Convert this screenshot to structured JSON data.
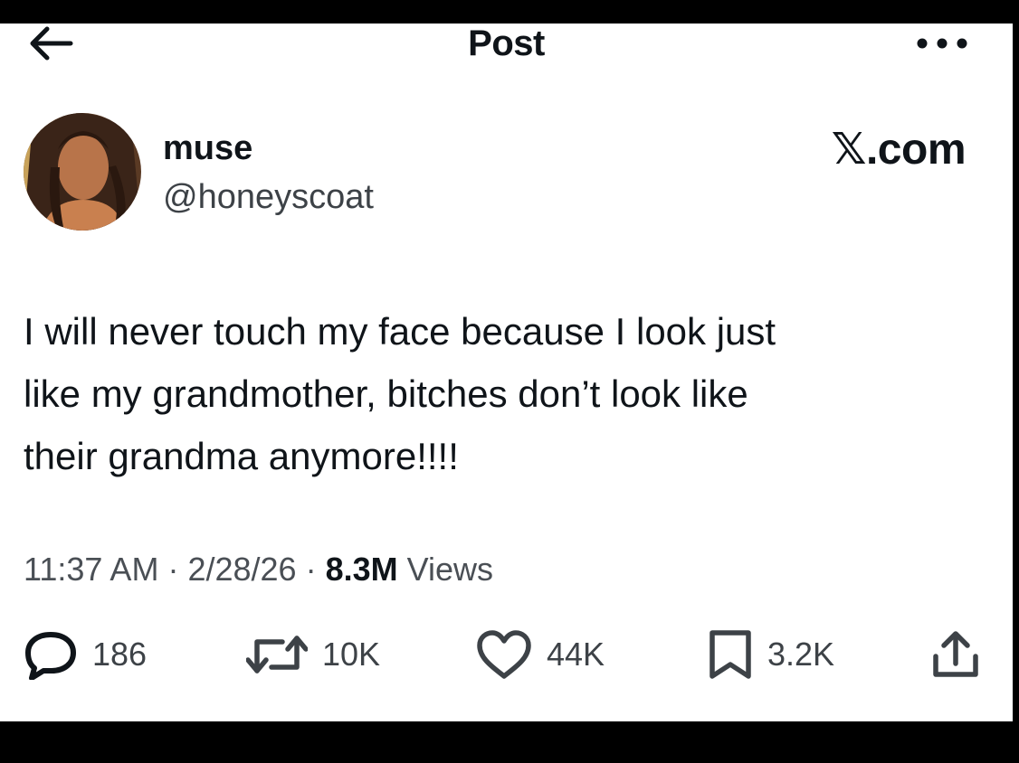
{
  "header": {
    "back_icon": "arrow-left-icon",
    "title": "Post",
    "more_icon": "more-horizontal-icon"
  },
  "author": {
    "display_name": "muse",
    "handle": "@honeyscoat",
    "avatar": "profile-photo"
  },
  "brand": "𝕏.com",
  "tweet": {
    "line1": "I will never touch my face because I look just",
    "line2": "like my grandmother, bitches don’t look like",
    "line3": "their grandma anymore!!!!"
  },
  "meta": {
    "time": "11:37 AM",
    "sep1": " · ",
    "date": "2/28/26",
    "sep2": " · ",
    "views_count": "8.3M",
    "views_label": " Views"
  },
  "actions": {
    "replies": "186",
    "reposts": "10K",
    "likes": "44K",
    "bookmarks": "3.2K"
  },
  "colors": {
    "text": "#0f1419",
    "secondary": "#4a4f55",
    "background": "#ffffff",
    "frame": "#000000"
  }
}
